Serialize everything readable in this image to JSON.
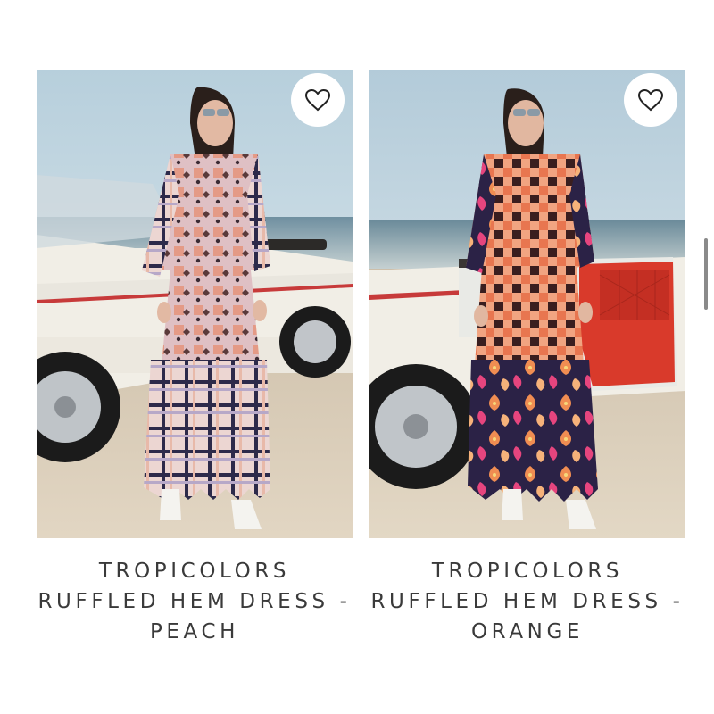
{
  "products": [
    {
      "name": "TROPICOLORS RUFFLED HEM DRESS - PEACH",
      "favorite_icon": "heart-outline-icon"
    },
    {
      "name": "TROPICOLORS RUFFLED HEM DRESS - ORANGE",
      "favorite_icon": "heart-outline-icon"
    }
  ],
  "colors": {
    "background": "#ffffff",
    "title_text": "#3a3a3a",
    "peach_dress": "#e8a89a",
    "orange_dress": "#e8835a",
    "car_red": "#d93a2b"
  }
}
